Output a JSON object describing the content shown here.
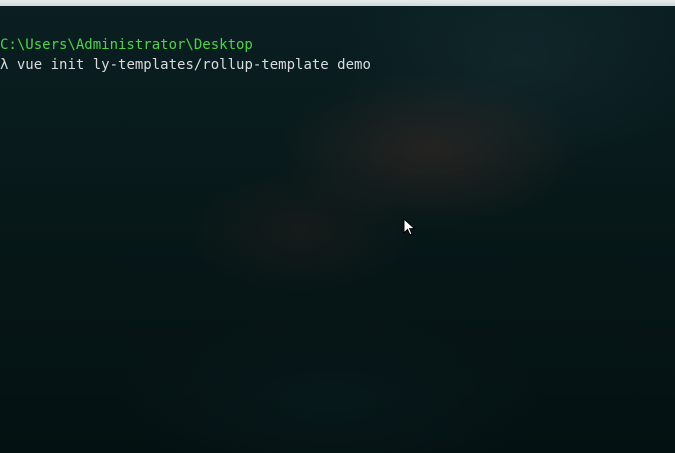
{
  "terminal": {
    "cwd": "C:\\Users\\Administrator\\Desktop",
    "prompt_symbol": "λ",
    "command": " vue init ly-templates/rollup-template demo"
  },
  "colors": {
    "path": "#4fd34a",
    "text": "#d9dcdc",
    "background": "#061517"
  },
  "icons": {
    "mouse_cursor": "arrow-cursor-icon"
  }
}
